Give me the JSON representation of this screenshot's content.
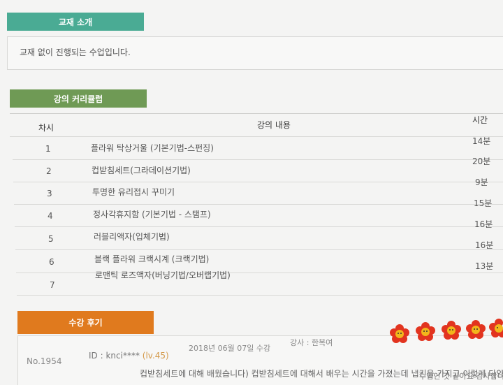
{
  "textbook": {
    "tab": "교재 소개",
    "text": "교재 없이 진행되는 수업입니다."
  },
  "curriculum": {
    "tab": "강의 커리큘럼",
    "headers": {
      "order": "차시",
      "content": "강의 내용",
      "time": "시간"
    },
    "rows": [
      {
        "no": "1",
        "title": "플라워 탁상거울 (기본기법-스펀징)",
        "time": "14분"
      },
      {
        "no": "2",
        "title": "컵받침세트(그라데이션기법)",
        "time": "20분"
      },
      {
        "no": "3",
        "title": "투명한 유리접시 꾸미기",
        "time": "9분"
      },
      {
        "no": "4",
        "title": "정사각휴지함 (기본기법 - 스탬프)",
        "time": "15분"
      },
      {
        "no": "5",
        "title": "러블리액자(입체기법)",
        "time": "16분"
      },
      {
        "no": "6",
        "title": "블랙 플라워 크랙시계 (크랙기법)",
        "time": "16분"
      },
      {
        "no": "7",
        "title": "로맨틱 로즈액자(버닝기법/오버랩기법)",
        "time": "13분"
      }
    ]
  },
  "review": {
    "tab": "수강 후기",
    "no": "No.1954",
    "id": "ID : knci****",
    "level": "(lv.45)",
    "date": "2018년 06월 07일 수강",
    "teacher": "강사 : 한복여",
    "body_line1": "컵받침세트에 대해 배웠습니다) 컵받침세트에 대해서 배우는 시간을 가졌는데 냅킨을 가지고 이렇게 다양한 아트",
    "body_line2": "수업인 것 같아요 감사합니다",
    "rating_icon": "flower-rating-icon",
    "colors": {
      "flower": "#e2341f",
      "center": "#f2b61c"
    }
  }
}
